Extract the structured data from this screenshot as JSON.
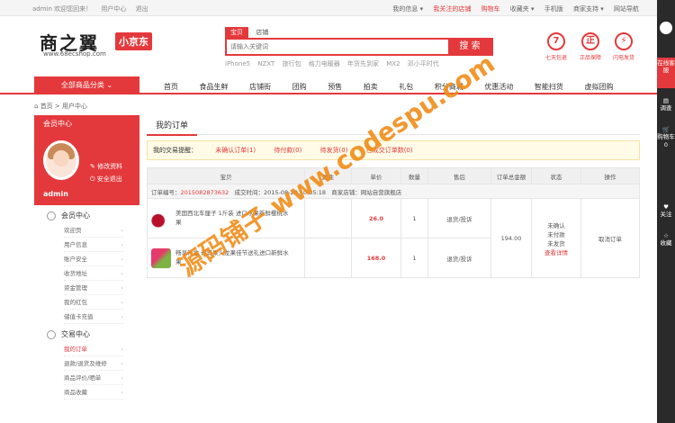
{
  "topbar": {
    "left": [
      "admin 欢迎您回来！",
      "用户中心",
      "退出"
    ],
    "right": [
      "我的信息 ▾",
      "我关注的店铺",
      "购物车",
      "收藏夹 ▾",
      "手机版",
      "商家支持 ▾",
      "网站导航"
    ]
  },
  "logo": {
    "name": "商之翼",
    "sub": "小京东",
    "url": "www.68ecshop.com"
  },
  "search": {
    "tabs": [
      "宝贝",
      "店铺"
    ],
    "placeholder": "请输入关键词",
    "button": "搜 索",
    "hot": [
      "iPhone5",
      "NZXT",
      "旅行包",
      "格力电暖器",
      "年货先到家",
      "MX2",
      "邓小平时代"
    ]
  },
  "guarantee": [
    {
      "icon": "7",
      "label": "七天包退"
    },
    {
      "icon": "正",
      "label": "正品保障"
    },
    {
      "icon": "⚡",
      "label": "闪电发货"
    }
  ],
  "nav": {
    "category": "全部商品分类",
    "items": [
      "首页",
      "食品生鲜",
      "店铺街",
      "团购",
      "预售",
      "拍卖",
      "礼包",
      "积分商城",
      "优惠活动",
      "智能扫货",
      "虚拟团购"
    ]
  },
  "breadcrumb": [
    "首页",
    "用户中心"
  ],
  "left": {
    "header": "会员中心",
    "username": "admin",
    "actions": [
      "修改资料",
      "安全退出"
    ],
    "sections": [
      {
        "title": "会员中心",
        "items": [
          "欢迎页",
          "用户信息",
          "账户安全",
          "收货地址",
          "资金管理",
          "我的红包",
          "储值卡充值"
        ]
      },
      {
        "title": "交易中心",
        "items": [
          "我的订单",
          "退款/退货及维修",
          "商品评价/晒单",
          "商品收藏"
        ]
      }
    ]
  },
  "main": {
    "title": "我的订单",
    "tips": {
      "label": "我的交易提醒：",
      "items": [
        "未确认订单(1)",
        "待付款(0)",
        "待发货(0)",
        "已成交订单数(0)"
      ]
    },
    "columns": [
      "宝贝",
      "属性",
      "单价",
      "数量",
      "售后",
      "订单总金额",
      "状态",
      "操作"
    ],
    "order": {
      "no_label": "订单编号：",
      "no": "2015082873632",
      "time": "成交时间：2015-08-28 10:35:18",
      "store": "商家店铺：网站自营旗舰店",
      "items": [
        {
          "name": "美国西北车厘子 1斤装 进口水果新鲜樱桃水果",
          "price": "26.0",
          "qty": "1",
          "after": "退货/投诉"
        },
        {
          "name": "畅享礼盒 奇异果火龙果佳节送礼进口新鲜水果",
          "price": "168.0",
          "qty": "1",
          "after": "退货/投诉"
        }
      ],
      "total": "194.00",
      "status": [
        "未确认",
        "未付款",
        "未发货"
      ],
      "detail": "查看详情",
      "op": "取消订单"
    }
  },
  "sidebar": {
    "blocks": [
      "在线客服",
      "调查",
      "购物车",
      "0",
      "关注",
      "收藏"
    ]
  },
  "watermark": "源码铺子 www.codespu.com"
}
